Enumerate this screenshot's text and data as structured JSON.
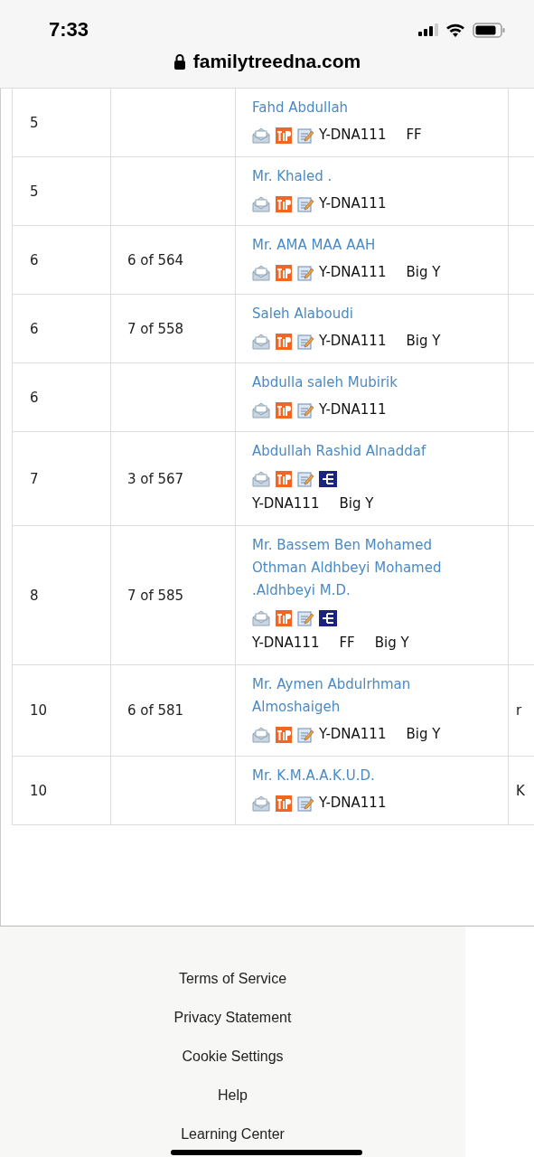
{
  "status_bar": {
    "time": "7:33"
  },
  "address_bar": {
    "url": "familytreedna.com"
  },
  "table": {
    "rows": [
      {
        "column_1": "5",
        "column_2": "",
        "name": "Fahd Abdullah",
        "icons": [
          {
            "kind": "mail"
          },
          {
            "kind": "tip"
          },
          {
            "kind": "edit"
          }
        ],
        "tests": [
          "Y-DNA111",
          "FF"
        ],
        "column_4": ""
      },
      {
        "column_1": "5",
        "column_2": "",
        "name": "Mr. Khaled .",
        "icons": [
          {
            "kind": "mail"
          },
          {
            "kind": "tip"
          },
          {
            "kind": "edit"
          }
        ],
        "tests": [
          "Y-DNA111"
        ],
        "column_4": ""
      },
      {
        "column_1": "6",
        "column_2": "6 of 564",
        "name": "Mr. AMA MAA AAH",
        "icons": [
          {
            "kind": "mail"
          },
          {
            "kind": "tip"
          },
          {
            "kind": "edit"
          }
        ],
        "tests": [
          "Y-DNA111",
          "Big Y"
        ],
        "column_4": ""
      },
      {
        "column_1": "6",
        "column_2": "7 of 558",
        "name": "Saleh Alaboudi",
        "icons": [
          {
            "kind": "mail"
          },
          {
            "kind": "tip"
          },
          {
            "kind": "edit"
          }
        ],
        "tests": [
          "Y-DNA111",
          "Big Y"
        ],
        "column_4": ""
      },
      {
        "column_1": "6",
        "column_2": "",
        "name": "Abdulla saleh Mubirik",
        "icons": [
          {
            "kind": "mail"
          },
          {
            "kind": "tip"
          },
          {
            "kind": "edit"
          }
        ],
        "tests": [
          "Y-DNA111"
        ],
        "column_4": ""
      },
      {
        "column_1": "7",
        "column_2": "3 of 567",
        "name": "Abdullah Rashid Alnaddaf",
        "icons": [
          {
            "kind": "mail"
          },
          {
            "kind": "tip"
          },
          {
            "kind": "edit"
          },
          {
            "kind": "tree"
          }
        ],
        "tests": [
          "Y-DNA111",
          "Big Y"
        ],
        "column_4": ""
      },
      {
        "column_1": "8",
        "column_2": "7 of 585",
        "name": "Mr. Bassem Ben Mohamed Othman Aldhbeyi Mohamed .Aldhbeyi M.D.",
        "icons": [
          {
            "kind": "mail"
          },
          {
            "kind": "tip"
          },
          {
            "kind": "edit"
          },
          {
            "kind": "tree"
          }
        ],
        "tests": [
          "Y-DNA111",
          "FF",
          "Big Y"
        ],
        "column_4": ""
      },
      {
        "column_1": "10",
        "column_2": "6 of 581",
        "name": "Mr. Aymen Abdulrhman Almoshaigeh",
        "icons": [
          {
            "kind": "mail"
          },
          {
            "kind": "tip"
          },
          {
            "kind": "edit"
          }
        ],
        "tests": [
          "Y-DNA111",
          "Big Y"
        ],
        "column_4": "r"
      },
      {
        "column_1": "10",
        "column_2": "",
        "name": "Mr. K.M.A.A.K.U.D.",
        "icons": [
          {
            "kind": "mail"
          },
          {
            "kind": "tip"
          },
          {
            "kind": "edit"
          }
        ],
        "tests": [
          "Y-DNA111"
        ],
        "column_4": "K"
      }
    ]
  },
  "footer": {
    "links": [
      "Terms of Service",
      "Privacy Statement",
      "Cookie Settings",
      "Help",
      "Learning Center"
    ]
  }
}
